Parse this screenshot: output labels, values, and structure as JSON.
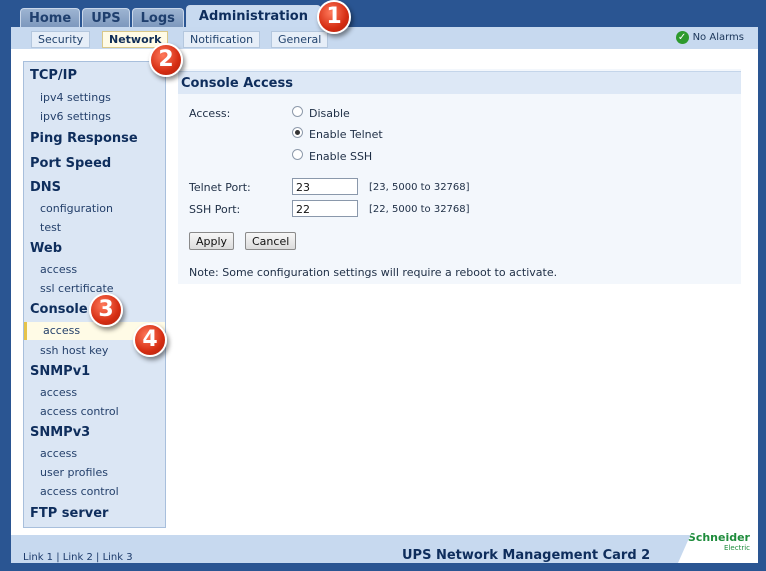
{
  "tabs": [
    "Home",
    "UPS",
    "Logs",
    "Administration"
  ],
  "subtabs": [
    "Security",
    "Network",
    "Notification",
    "General"
  ],
  "alarm_status": "No Alarms",
  "sidebar": {
    "tcpip": "TCP/IP",
    "ipv4": "ipv4 settings",
    "ipv6": "ipv6 settings",
    "ping": "Ping Response",
    "speed": "Port Speed",
    "dns": "DNS",
    "dns_config": "configuration",
    "dns_test": "test",
    "web": "Web",
    "web_access": "access",
    "web_ssl": "ssl certificate",
    "console": "Console",
    "console_access": "access",
    "console_ssh": "ssh host key",
    "snmpv1": "SNMPv1",
    "snmpv1_access": "access",
    "snmpv1_control": "access control",
    "snmpv3": "SNMPv3",
    "snmpv3_access": "access",
    "snmpv3_profiles": "user profiles",
    "snmpv3_control": "access control",
    "ftp": "FTP server"
  },
  "content": {
    "title": "Console Access",
    "access_label": "Access:",
    "opt_disable": "Disable",
    "opt_telnet": "Enable Telnet",
    "opt_ssh": "Enable SSH",
    "telnet_label": "Telnet Port:",
    "telnet_value": "23",
    "telnet_hint": "[23, 5000 to 32768]",
    "ssh_label": "SSH Port:",
    "ssh_value": "22",
    "ssh_hint": "[22, 5000 to 32768]",
    "apply": "Apply",
    "cancel": "Cancel",
    "note": "Note: Some configuration settings will require a reboot to activate."
  },
  "footer": {
    "link1": "Link 1",
    "link2": "Link 2",
    "link3": "Link 3",
    "sep": "|",
    "title": "UPS Network Management Card 2",
    "logo_main": "Schneider",
    "logo_sub": "Electric"
  },
  "callouts": [
    "1",
    "2",
    "3",
    "4"
  ],
  "colors": {
    "accent": "#2a5592",
    "panel": "#dbe6f4",
    "callout": "#d52d12"
  }
}
